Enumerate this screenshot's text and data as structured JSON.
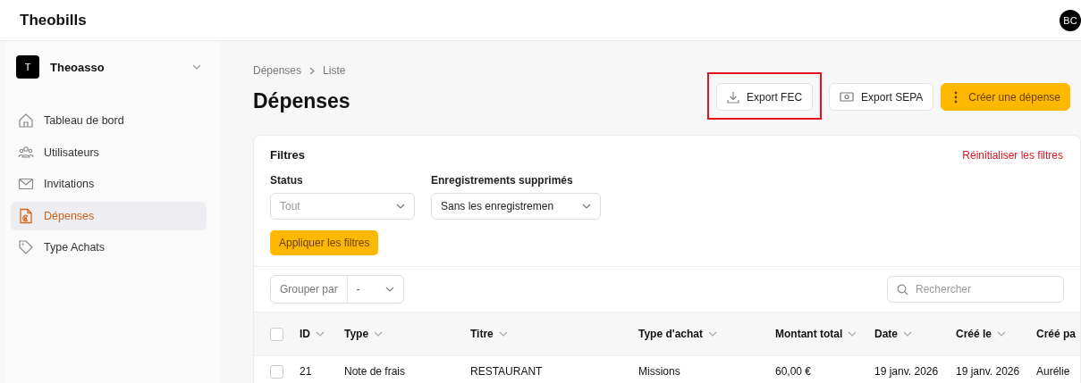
{
  "app": {
    "name": "Theobills",
    "user_initials": "BC"
  },
  "sidebar": {
    "organization": {
      "initial": "T",
      "name": "Theoasso"
    },
    "items": [
      {
        "label": "Tableau de bord",
        "selected": false
      },
      {
        "label": "Utilisateurs",
        "selected": false
      },
      {
        "label": "Invitations",
        "selected": false
      },
      {
        "label": "Dépenses",
        "selected": true
      },
      {
        "label": "Type Achats",
        "selected": false
      }
    ]
  },
  "breadcrumb": [
    "Dépenses",
    "Liste"
  ],
  "title": "Dépenses",
  "actions": [
    {
      "label": "Export FEC",
      "kind": "download",
      "highlighted": true
    },
    {
      "label": "Export SEPA",
      "kind": "money",
      "highlighted": false
    },
    {
      "label": "Créer une dépense",
      "kind": "primary",
      "highlighted": false
    }
  ],
  "filters": {
    "title": "Filtres",
    "reset": "Réinitialiser les filtres",
    "fields": [
      {
        "label": "Status",
        "placeholder": "Tout"
      },
      {
        "label": "Enregistrements supprimés",
        "value": "Sans les enregistremen"
      }
    ],
    "apply": "Appliquer les filtres"
  },
  "toolbar": {
    "group_by": {
      "label": "Grouper par",
      "value": "-"
    },
    "search": {
      "placeholder": "Rechercher"
    }
  },
  "table": {
    "all_checked": false,
    "columns": [
      "ID",
      "Type",
      "Titre",
      "Type d'achat",
      "Montant total",
      "Date",
      "Créé le",
      "Créé pa"
    ],
    "rows": [
      {
        "checked": false,
        "cells": [
          "21",
          "Note de frais",
          "RESTAURANT",
          "Missions",
          "60,00 €",
          "19 janv. 2026",
          "19 janv. 2026",
          "Aurélie"
        ]
      }
    ]
  }
}
